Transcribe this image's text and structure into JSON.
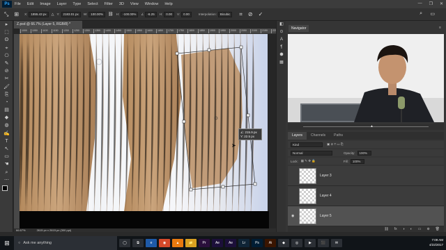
{
  "app": {
    "logo": "Ps"
  },
  "menu": [
    "File",
    "Edit",
    "Image",
    "Layer",
    "Type",
    "Select",
    "Filter",
    "3D",
    "View",
    "Window",
    "Help"
  ],
  "window_controls": [
    "—",
    "❐",
    "✕"
  ],
  "options": {
    "x_label": "X:",
    "x_value": "1855.43 px",
    "y_label": "Y:",
    "y_value": "2183.01 px",
    "w_label": "W:",
    "w_value": "100.00%",
    "h_label": "H:",
    "h_value": "-100.00%",
    "angle_label": "∠",
    "angle_value": "-6.25",
    "hskew_label": "H:",
    "hskew_value": "0.00",
    "vskew_label": "V:",
    "vskew_value": "0.00",
    "interp_label": "Interpolation:",
    "interp_value": "Bicubic"
  },
  "tools": [
    "▸",
    "⬚",
    "ʘ",
    "⌖",
    "⎔",
    "✎",
    "⊘",
    "✂",
    "🖌",
    "⎘",
    "◔",
    "▤",
    "◆",
    "◍",
    "✍",
    "T",
    "↖",
    "▭",
    "☚",
    "⌕",
    "⋯"
  ],
  "document": {
    "tab": "Z.psd @ 66.7% (Layer 5, RGB/8) *",
    "ruler_ticks": [
      "1000",
      "1050",
      "1100",
      "1150",
      "1200",
      "1250",
      "1300",
      "1350",
      "1400",
      "1450",
      "1500",
      "1550",
      "1600",
      "1650",
      "1700",
      "1750",
      "1800",
      "1850",
      "1900",
      "1950",
      "2000",
      "2050",
      "2100",
      "2150",
      "2200"
    ],
    "readout_angle": "∠: 215.9 px",
    "readout_y": "Y: 22.5 px",
    "zoom": "66.67%",
    "doc_size": "2615 px x 2615 px (300 ppi)"
  },
  "right_icons": [
    "◧",
    "⊙",
    "A",
    "¶",
    "⬢",
    "▦"
  ],
  "navigator": {
    "tab": "Navigator"
  },
  "layers_panel": {
    "tabs": [
      "Layers",
      "Channels",
      "Paths"
    ],
    "kind": "Kind",
    "blend": "Normal",
    "opacity_label": "Opacity:",
    "opacity": "100%",
    "lock_label": "Lock:",
    "fill_label": "Fill:",
    "fill": "100%",
    "layers": [
      {
        "name": "Layer 3",
        "visible": false,
        "selected": false
      },
      {
        "name": "Layer 4",
        "visible": false,
        "selected": false
      },
      {
        "name": "Layer 5",
        "visible": true,
        "selected": true
      }
    ],
    "footer_icons": [
      "⛓",
      "fx",
      "◑",
      "◐",
      "▭",
      "⊕",
      "🗑"
    ]
  },
  "taskbar": {
    "search": "Ask me anything",
    "apps": [
      {
        "label": "◯",
        "color": "#2b2f35"
      },
      {
        "label": "⧉",
        "color": "#2b2f35"
      },
      {
        "label": "e",
        "color": "#1e5aa8"
      },
      {
        "label": "◉",
        "color": "#d6492a"
      },
      {
        "label": "▲",
        "color": "#e8790f"
      },
      {
        "label": "📁",
        "color": "#d9a021"
      },
      {
        "label": "Pr",
        "color": "#2a0f3b"
      },
      {
        "label": "Ae",
        "color": "#1c0f3a"
      },
      {
        "label": "Ae",
        "color": "#1c0f3a"
      },
      {
        "label": "Lr",
        "color": "#0f2436"
      },
      {
        "label": "Ps",
        "color": "#001d34"
      },
      {
        "label": "Ai",
        "color": "#3a1500"
      },
      {
        "label": "◆",
        "color": "#2b2f35"
      },
      {
        "label": "◎",
        "color": "#2b2f35"
      },
      {
        "label": "▶",
        "color": "#2b2f35"
      },
      {
        "label": "⬛",
        "color": "#2b2f35"
      },
      {
        "label": "✉",
        "color": "#2b2f35"
      }
    ],
    "time": "7:09 AM",
    "date": "4/22/2017"
  }
}
